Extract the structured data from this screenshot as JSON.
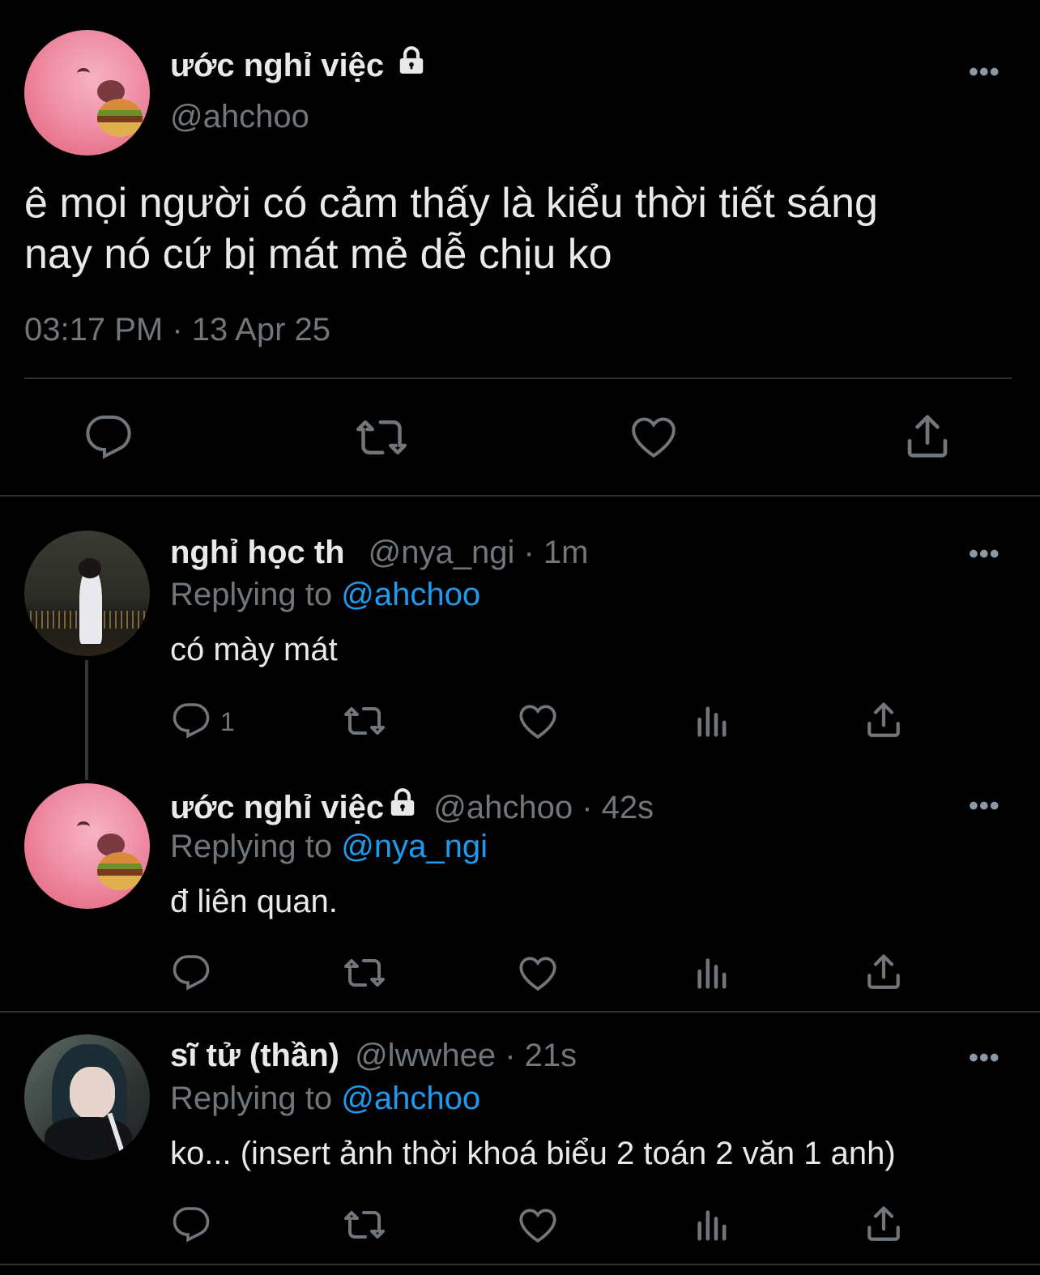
{
  "main_tweet": {
    "display_name": "ước nghỉ việc",
    "handle": "@ahchoo",
    "text_line1": "ê mọi người có cảm thấy là kiểu thời tiết sáng",
    "text_line2": "nay nó cứ bị mát mẻ dễ chịu ko",
    "timestamp": "03:17 PM · 13 Apr 25",
    "locked_icon": "lock-icon",
    "actions": [
      "reply-icon",
      "retweet-icon",
      "like-icon",
      "share-icon"
    ]
  },
  "replies": [
    {
      "display_name": "nghỉ học th",
      "handle_time": "@nya_ngi · 1m",
      "replying_prefix": "Replying to",
      "replying_to": "@ahchoo",
      "text": "có mày mát",
      "reply_count": "1"
    },
    {
      "display_name": "ước nghỉ việc",
      "handle_time": "@ahchoo · 42s",
      "replying_prefix": "Replying to",
      "replying_to": "@nya_ngi",
      "text": "đ liên quan.",
      "reply_count": ""
    },
    {
      "display_name": "sĩ tử (thần)",
      "handle_time": "@lwwhee · 21s",
      "replying_prefix": "Replying to",
      "replying_to": "@ahchoo",
      "text": "ko... (insert ảnh thời khoá biểu 2 toán 2 văn 1 anh)",
      "reply_count": ""
    }
  ],
  "more_label": "•••",
  "colors": {
    "background": "#000000",
    "text": "#e7e9ea",
    "muted": "#71767b",
    "link": "#1d9bf0",
    "divider": "#2f3336"
  }
}
